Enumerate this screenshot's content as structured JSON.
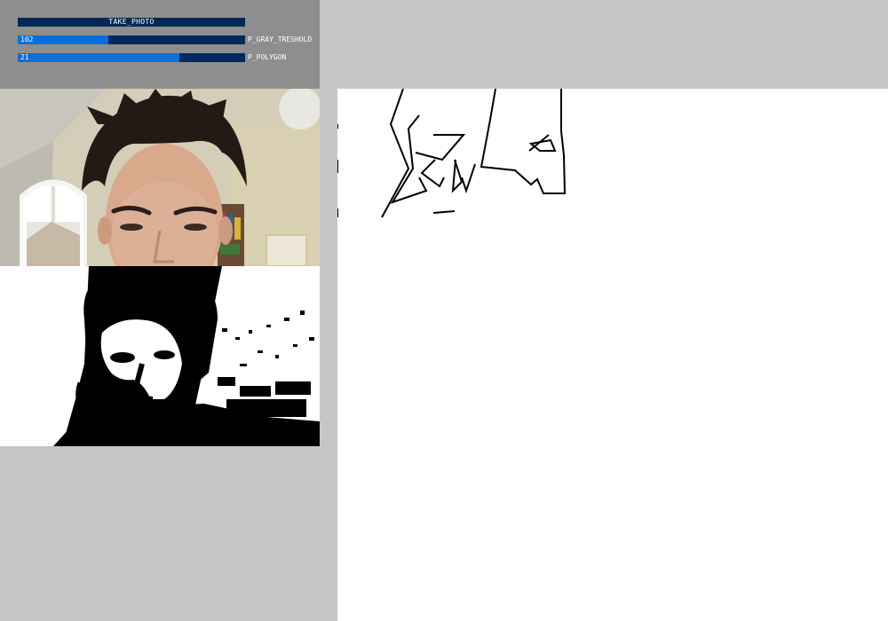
{
  "controls": {
    "take_photo_label": "TAKE_PHOTO",
    "gray_threshold": {
      "value": "102",
      "label": "P_GRAY_TRESHOLD",
      "fill_fraction": 0.4
    },
    "polygon": {
      "value": "21",
      "label": "P_POLYGON",
      "fill_fraction": 0.71
    }
  },
  "colors": {
    "background": "#c6c6c6",
    "panel": "#8e8e8e",
    "control_bg": "#022859",
    "control_fill": "#0a6fd9",
    "control_text": "#ffffff"
  }
}
